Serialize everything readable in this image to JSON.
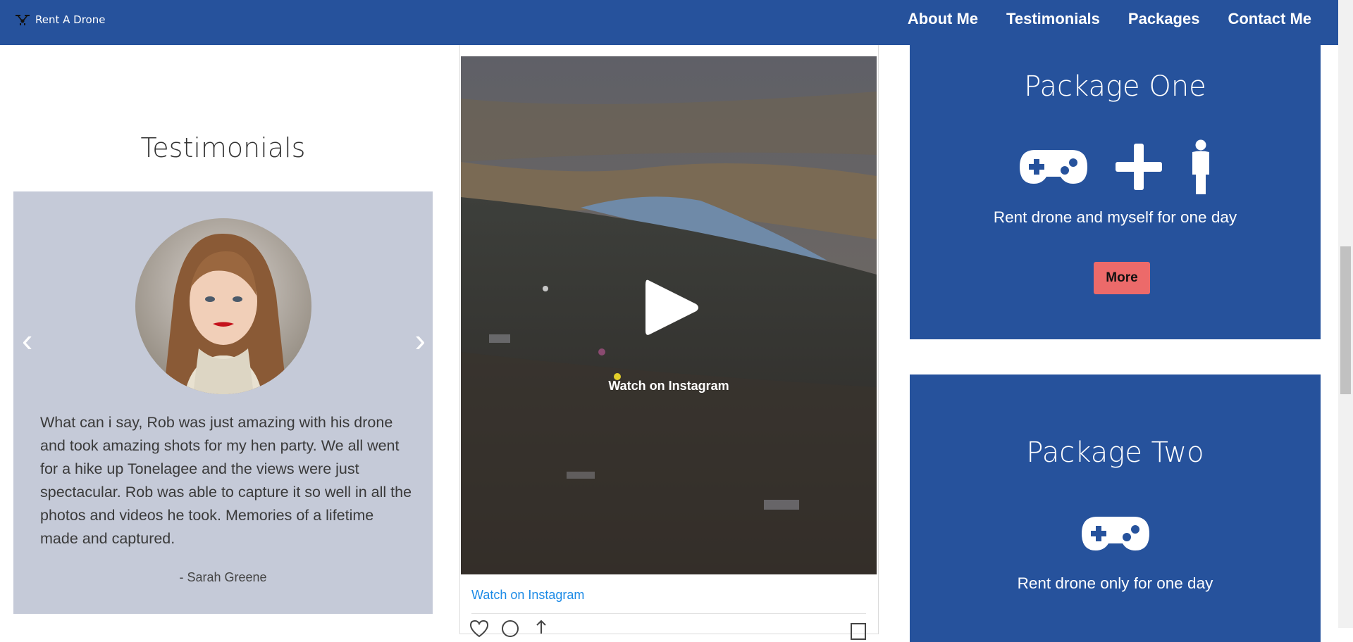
{
  "brand": {
    "name": "Rent A Drone",
    "icon": "drone-icon"
  },
  "nav": {
    "items": [
      {
        "label": "About Me"
      },
      {
        "label": "Testimonials"
      },
      {
        "label": "Packages"
      },
      {
        "label": "Contact Me"
      }
    ]
  },
  "testimonials": {
    "heading": "Testimonials",
    "prev_arrow": "‹",
    "next_arrow": "›",
    "quote": "What can i say, Rob was just amazing with his drone and took amazing shots for my hen party. We all went for a hike up Tonelagee and the views were just spectacular. Rob was able to capture it so well in all the photos and videos he took. Memories of a lifetime made and captured.",
    "author": "- Sarah Greene"
  },
  "instagram": {
    "video_overlay_text": "Watch on Instagram",
    "link_text": "Watch on Instagram",
    "link_color": "#1b8ae6",
    "icons": [
      "heart-icon",
      "comment-icon",
      "share-icon",
      "bookmark-icon"
    ]
  },
  "packages": [
    {
      "title": "Package One",
      "description": "Rent drone and myself for one day",
      "button": "More",
      "icons": [
        "gamepad-icon",
        "plus-icon",
        "person-icon"
      ]
    },
    {
      "title": "Package Two",
      "description": "Rent drone only for one day",
      "icons": [
        "gamepad-icon"
      ]
    }
  ],
  "colors": {
    "nav_bg": "#26529c",
    "package_bg": "#26529c",
    "testimonial_card_bg": "#c5cad8",
    "more_button_bg": "#ec6a6a"
  }
}
